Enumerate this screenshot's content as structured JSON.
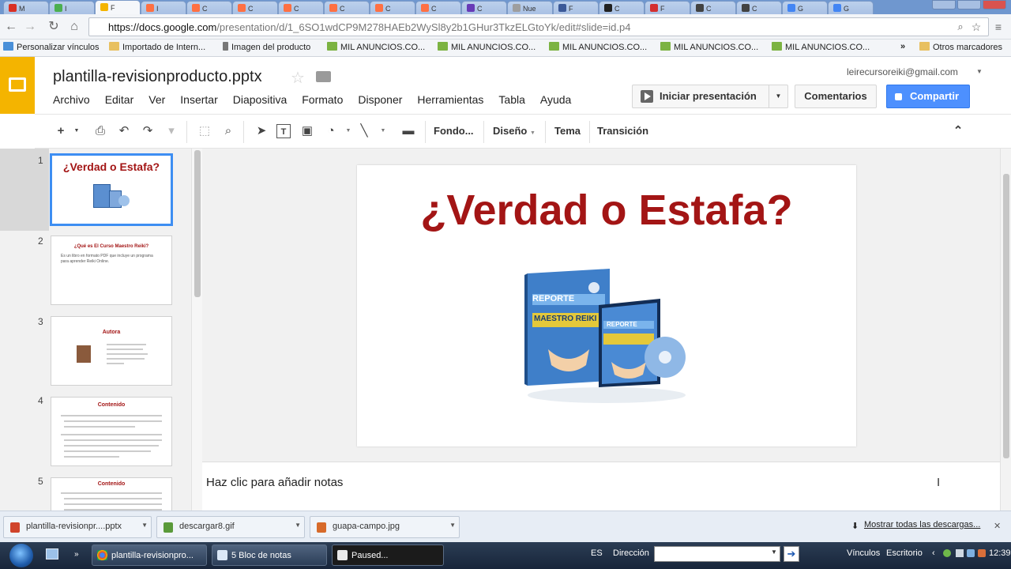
{
  "browser": {
    "tabs": [
      {
        "label": "M",
        "color": "#d93025"
      },
      {
        "label": "I",
        "color": "#4caf50"
      },
      {
        "label": "F",
        "color": "#f4b400"
      },
      {
        "label": "I",
        "color": "#ff7043"
      },
      {
        "label": "C",
        "color": "#ff7043"
      },
      {
        "label": "C",
        "color": "#ff7043"
      },
      {
        "label": "C",
        "color": "#ff7043"
      },
      {
        "label": "C",
        "color": "#ff7043"
      },
      {
        "label": "C",
        "color": "#ff7043"
      },
      {
        "label": "C",
        "color": "#ff7043"
      },
      {
        "label": "C",
        "color": "#673ab7"
      },
      {
        "label": "Nue",
        "color": "#9e9e9e"
      },
      {
        "label": "F",
        "color": "#3b5998"
      },
      {
        "label": "C",
        "color": "#212121"
      },
      {
        "label": "F",
        "color": "#d32f2f"
      },
      {
        "label": "C",
        "color": "#424242"
      },
      {
        "label": "C",
        "color": "#424242"
      },
      {
        "label": "G",
        "color": "#4285f4"
      },
      {
        "label": "G",
        "color": "#4285f4"
      }
    ],
    "url_host": "https://docs.google.com",
    "url_path": "/presentation/d/1_6SO1wdCP9M278HAEb2WySl8y2b1GHur3TkzELGtoYk/edit#slide=id.p4",
    "bookmarks": [
      "Personalizar vínculos",
      "Importado de Intern...",
      "Imagen del producto",
      "MIL ANUNCIOS.CO...",
      "MIL ANUNCIOS.CO...",
      "MIL ANUNCIOS.CO...",
      "MIL ANUNCIOS.CO...",
      "MIL ANUNCIOS.CO...",
      "Otros marcadores"
    ],
    "bookmarks_more": "»"
  },
  "doc": {
    "title": "plantilla-revisionproducto.pptx",
    "user_email": "leirecursoreiki@gmail.com",
    "menus": [
      "Archivo",
      "Editar",
      "Ver",
      "Insertar",
      "Diapositiva",
      "Formato",
      "Disponer",
      "Herramientas",
      "Tabla",
      "Ayuda"
    ],
    "present_label": "Iniciar presentación",
    "comments_label": "Comentarios",
    "share_label": "Compartir"
  },
  "toolbar": {
    "fondo": "Fondo...",
    "diseno": "Diseño",
    "tema": "Tema",
    "transicion": "Transición"
  },
  "slides": [
    {
      "num": "1",
      "title": "¿Verdad o Estafa?"
    },
    {
      "num": "2",
      "title": "¿Qué es El Curso Maestro Reiki?",
      "bullet": "Es un libro en formato PDF que incluye un programa para aprender Reiki Online."
    },
    {
      "num": "3",
      "title": "Autora"
    },
    {
      "num": "4",
      "title": "Contenido"
    },
    {
      "num": "5",
      "title": "Contenido"
    }
  ],
  "current_slide": {
    "title": "¿Verdad o Estafa?",
    "product_label_1": "REPORTE",
    "product_label_2": "MAESTRO REIKI",
    "product_label_3": "REPORTE"
  },
  "notes_placeholder": "Haz clic para añadir notas",
  "downloads": {
    "items": [
      "plantilla-revisionpr....pptx",
      "descargar8.gif",
      "guapa-campo.jpg"
    ],
    "show_all": "Mostrar todas las descargas..."
  },
  "taskbar": {
    "tasks": [
      "plantilla-revisionpro...",
      "5 Bloc de notas",
      "Paused..."
    ],
    "lang": "ES",
    "address_label": "Dirección",
    "vinculos": "Vínculos",
    "escritorio": "Escritorio",
    "clock": "12:39"
  },
  "colors": {
    "accent_red": "#a31515",
    "share_blue": "#4d90fe",
    "slides_yellow": "#f4b400"
  }
}
